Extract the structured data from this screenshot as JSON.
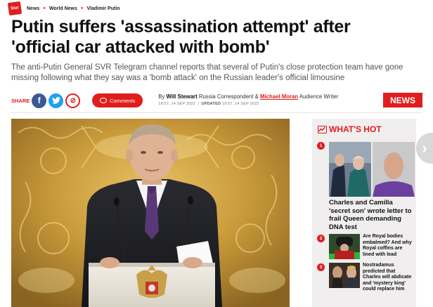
{
  "breadcrumbs": [
    "News",
    "World News",
    "Vladimir Putin"
  ],
  "logo_text": "Daily Star",
  "headline": "Putin suffers 'assassination attempt' after 'official car attacked with bomb'",
  "standfirst": "The anti-Putin General SVR Telegram channel reports that several of Putin's close protection team have gone missing following what they say was a 'bomb attack' on the Russian leader's official limousine",
  "share": {
    "label": "SHARE",
    "comments_label": "Comments"
  },
  "byline": {
    "prefix": "By",
    "author1": "Will Stewart",
    "role1": "Russia Correspondent &",
    "author2": "Michael Moran",
    "role2": "Audience Writer",
    "published": "18:57, 14 SEP 2022",
    "updated_label": "UPDATED",
    "updated": "19:57, 14 SEP 2022"
  },
  "section_badge": "NEWS",
  "whats_hot": {
    "title": "WHAT'S HOT",
    "items": [
      {
        "num": "1",
        "title": "Charles and Camilla 'secret son' wrote letter to frail Queen demanding DNA test"
      },
      {
        "num": "2",
        "title": "Are Royal bodies embalmed? And why Royal coffins are lined with lead"
      },
      {
        "num": "3",
        "title": "Nostradamus predicted that Charles will abdicate and 'mystery king' could replace him"
      }
    ]
  },
  "colors": {
    "brand": "#e01d1d",
    "facebook": "#3b5998",
    "twitter": "#1da1f2"
  },
  "icons": [
    "facebook-icon",
    "twitter-icon",
    "link-icon",
    "comment-icon",
    "trending-icon",
    "chevron-right-icon"
  ]
}
